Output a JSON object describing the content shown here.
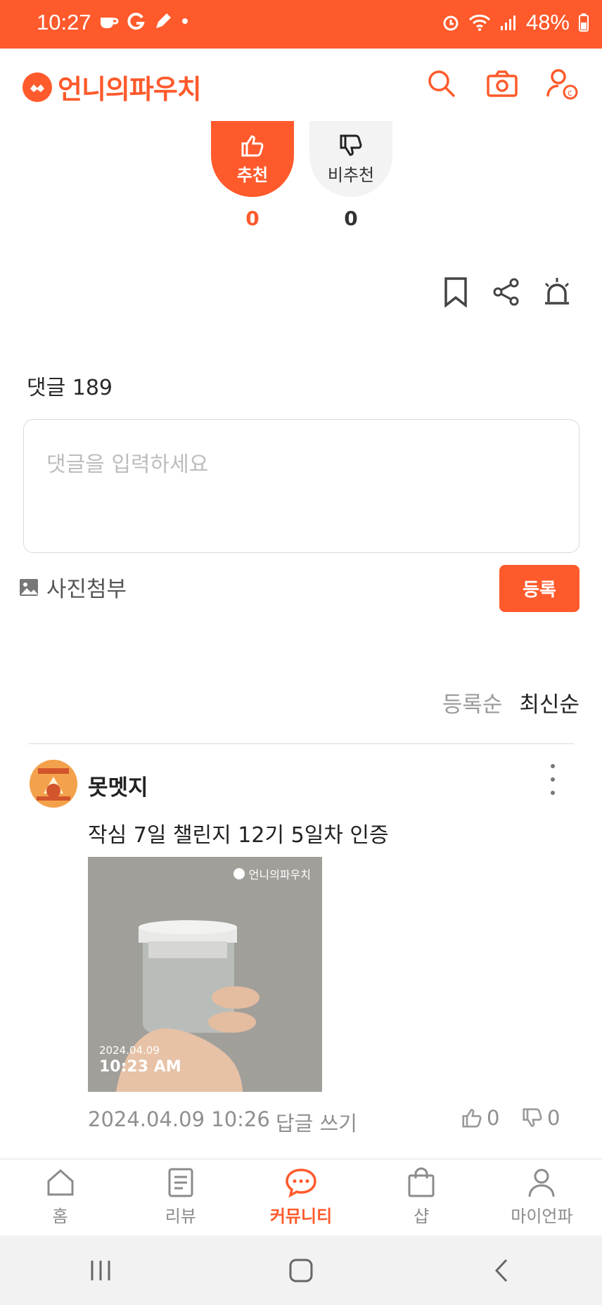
{
  "status": {
    "time": "10:27",
    "battery": "48%"
  },
  "app": {
    "brand": "언니의파우치"
  },
  "post": {
    "recommend": {
      "label": "추천",
      "count": "0"
    },
    "not_recommend": {
      "label": "비추천",
      "count": "0"
    }
  },
  "comments": {
    "title": "댓글 189",
    "placeholder": "댓글을 입력하세요",
    "attach_label": "사진첨부",
    "submit_label": "등록",
    "sort": {
      "registered": "등록순",
      "latest": "최신순"
    },
    "items": [
      {
        "author": "못멧지",
        "text": "작심 7일 챌린지 12기 5일차 인증",
        "photo": {
          "watermark": "언니의파우치",
          "date": "2024.04.09",
          "time": "10:23 AM"
        },
        "timestamp": "2024.04.09 10:26",
        "reply_label": "답글 쓰기",
        "likes": "0",
        "dislikes": "0"
      }
    ]
  },
  "tabs": [
    {
      "label": "홈",
      "icon": "home-icon"
    },
    {
      "label": "리뷰",
      "icon": "review-icon"
    },
    {
      "label": "커뮤니티",
      "icon": "community-icon"
    },
    {
      "label": "샵",
      "icon": "shop-bag-icon"
    },
    {
      "label": "마이언파",
      "icon": "profile-icon"
    }
  ],
  "colors": {
    "accent": "#FF5A2C"
  }
}
